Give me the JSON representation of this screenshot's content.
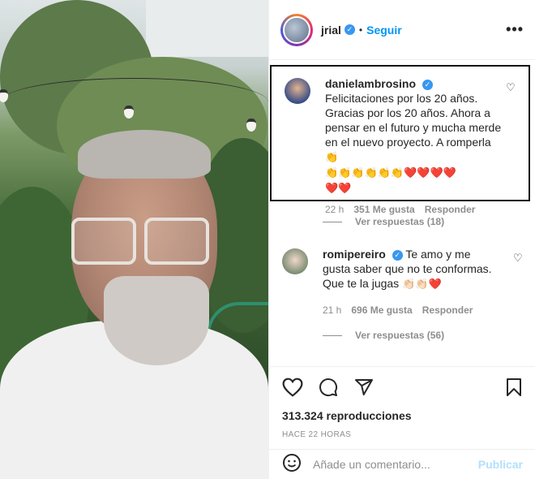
{
  "post": {
    "username": "jrial",
    "follow_label": "Seguir",
    "separator": "•",
    "more_label": "•••"
  },
  "comments": [
    {
      "username": "danielambrosino",
      "text": "Felicitaciones por los 20 años. Gracias por los 20 años. Ahora a pensar en el futuro y mucha merde en el nuevo proyecto. A romperla",
      "emoji_clap_first": "👏",
      "emoji_row": "👏👏👏👏👏👏",
      "emoji_hearts": "❤️❤️❤️❤️",
      "emoji_hearts_2": "❤️❤️",
      "time": "22 h",
      "likes": "351 Me gusta",
      "reply_label": "Responder",
      "view_replies": "Ver respuestas (18)"
    },
    {
      "username": "romipereiro",
      "text": "Te amo y me gusta saber que no te conformas. Que te la jugas",
      "emojis": "👏🏻👏🏻",
      "emoji_heart": "❤️",
      "time": "21 h",
      "likes": "696 Me gusta",
      "reply_label": "Responder",
      "view_replies": "Ver respuestas (56)"
    }
  ],
  "stats": {
    "views": "313.324 reproducciones",
    "time_ago": "HACE 22 HORAS"
  },
  "composer": {
    "placeholder": "Añade un comentario...",
    "post_label": "Publicar"
  },
  "icons": [
    "heart-icon",
    "comment-icon",
    "share-icon",
    "bookmark-icon",
    "emoji-icon",
    "verified-icon"
  ],
  "colors": {
    "accent": "#0095f6",
    "verified": "#3897f0",
    "post_disabled": "#b2dffc"
  }
}
